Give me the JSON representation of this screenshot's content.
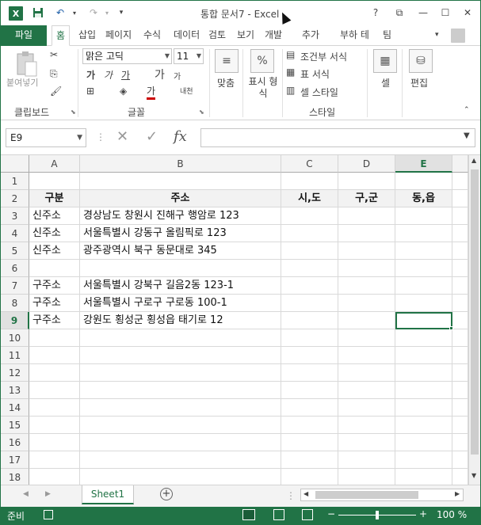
{
  "title": "통합 문서7 - Excel",
  "window": {
    "help": "?",
    "ribbon_display": "⧉",
    "minimize": "—",
    "restore": "☐",
    "close": "✕"
  },
  "qat": {
    "save_icon": "save-icon",
    "undo_icon": "undo-icon",
    "redo_icon": "redo-icon",
    "customize": "▾"
  },
  "tabs": [
    {
      "label": "파일"
    },
    {
      "label": "홈"
    },
    {
      "label": "삽입"
    },
    {
      "label": "페이지"
    },
    {
      "label": "수식"
    },
    {
      "label": "데이터"
    },
    {
      "label": "검토"
    },
    {
      "label": "보기"
    },
    {
      "label": "개발"
    },
    {
      "label": "추가"
    },
    {
      "label": "부하 테"
    },
    {
      "label": "팀"
    }
  ],
  "ribbon": {
    "paste_label": "붙여넣기",
    "clipboard_label": "클립보드",
    "font_name": "맑은 고딕",
    "font_size": "11",
    "font_group_label": "글꼴",
    "align_label": "맞춤",
    "number_label": "표시 형식",
    "conditional_format": "조건부 서식",
    "format_table": "표 서식",
    "cell_styles": "셀 스타일",
    "styles_label": "스타일",
    "cells_label": "셀",
    "edit_label": "편집",
    "percent_symbol": "%",
    "bold": "가",
    "italic": "가",
    "underline": "가",
    "grow": "가",
    "shrink": "가",
    "font_color": "가",
    "phonetic": "내천",
    "cells_icon": "▦",
    "edit_icon": "ﾞ"
  },
  "formula_bar": {
    "name_box": "E9",
    "cancel": "✕",
    "enter": "✓",
    "fx": "fx",
    "formula": ""
  },
  "columns": [
    "A",
    "B",
    "C",
    "D",
    "E"
  ],
  "rows": [
    "1",
    "2",
    "3",
    "4",
    "5",
    "6",
    "7",
    "8",
    "9",
    "10",
    "11",
    "12",
    "13",
    "14",
    "15",
    "16",
    "17",
    "18"
  ],
  "cells": {
    "r2": {
      "A": "구분",
      "B": "주소",
      "C": "시,도",
      "D": "구,군",
      "E": "동,읍"
    },
    "r3": {
      "A": "신주소",
      "B": "경상남도 창원시 진해구 행암로 123"
    },
    "r4": {
      "A": "신주소",
      "B": "서울특별시 강동구 올림픽로 123"
    },
    "r5": {
      "A": "신주소",
      "B": "광주광역시 북구 동문대로 345"
    },
    "r7": {
      "A": "구주소",
      "B": "서울특별시 강북구 길음2동 123-1"
    },
    "r8": {
      "A": "구주소",
      "B": "서울특별시 구로구 구로동 100-1"
    },
    "r9": {
      "A": "구주소",
      "B": "강원도 횡성군 횡성읍 태기로 12"
    }
  },
  "sheet_tab": "Sheet1",
  "add_sheet": "+",
  "status": {
    "ready": "준비",
    "zoom": "100 %",
    "zoom_minus": "−",
    "zoom_plus": "+"
  },
  "colors": {
    "accent": "#217346"
  }
}
